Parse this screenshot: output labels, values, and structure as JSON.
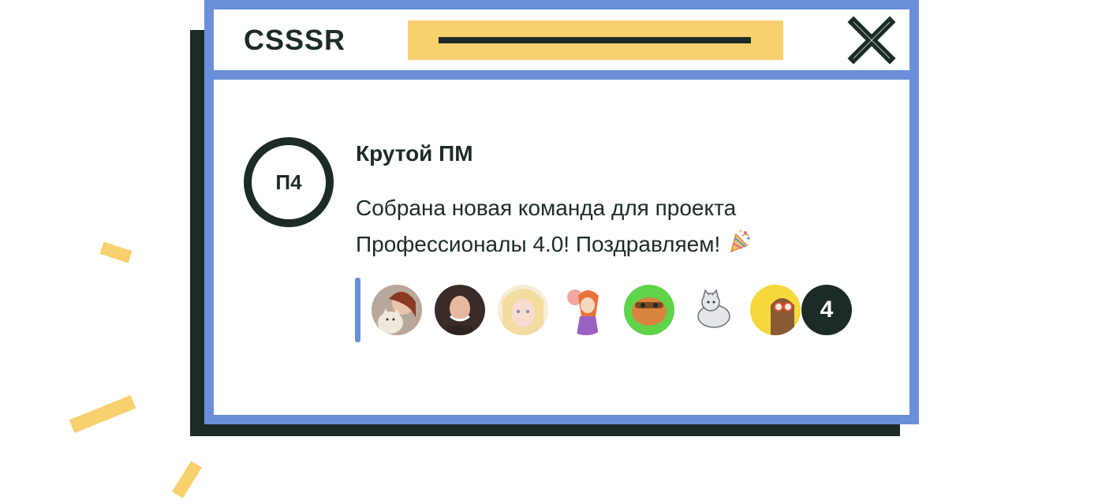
{
  "app": {
    "logo_text": "CSSSR"
  },
  "post": {
    "group_avatar_text": "П4",
    "author": "Крутой ПМ",
    "message_line1": "Собрана новая команда для проекта",
    "message_line2": "Профессионалы 4.0! Поздравляем!",
    "message_icon": "party-popper-icon"
  },
  "members": {
    "avatars": [
      "avatar-woman-cat",
      "avatar-woman-dark-hair",
      "avatar-woman-blonde",
      "avatar-cartoon-mouse",
      "avatar-cartoon-capybara",
      "avatar-cartoon-cat",
      "avatar-cartoon-bear"
    ],
    "more_count": "4"
  },
  "colors": {
    "frame": "#6a8fd8",
    "dark": "#1c2b26",
    "accent_yellow": "#f8d06e"
  }
}
